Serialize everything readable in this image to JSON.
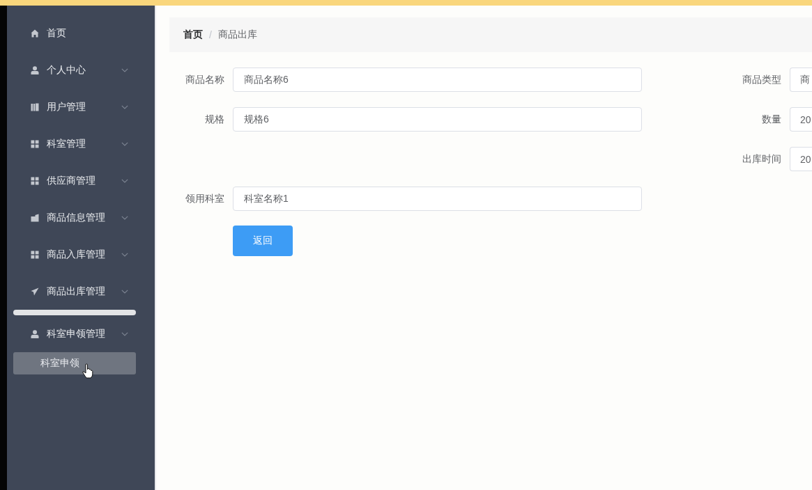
{
  "sidebar": {
    "items": [
      {
        "label": "首页",
        "kind": "link"
      },
      {
        "label": "个人中心",
        "kind": "submenu"
      },
      {
        "label": "用户管理",
        "kind": "submenu"
      },
      {
        "label": "科室管理",
        "kind": "submenu"
      },
      {
        "label": "供应商管理",
        "kind": "submenu"
      },
      {
        "label": "商品信息管理",
        "kind": "submenu"
      },
      {
        "label": "商品入库管理",
        "kind": "submenu"
      },
      {
        "label": "商品出库管理",
        "kind": "submenu"
      },
      {
        "kind": "bar"
      },
      {
        "label": "科室申领管理",
        "kind": "submenu",
        "children": [
          {
            "label": "科室申领"
          }
        ]
      }
    ]
  },
  "breadcrumb": {
    "items": [
      {
        "label": "首页"
      },
      {
        "label": "商品出库"
      }
    ],
    "separator": "/"
  },
  "form": {
    "rows": [
      {
        "left": {
          "label": "商品名称",
          "value": "商品名称6"
        },
        "right": {
          "label": "商品类型",
          "value": "商"
        }
      },
      {
        "left": {
          "label": "规格",
          "value": "规格6"
        },
        "right": {
          "label": "数量",
          "value": "20"
        }
      },
      {
        "right": {
          "label": "出库时间",
          "value": "20"
        }
      },
      {
        "left": {
          "label": "领用科室",
          "value": "科室名称1"
        }
      }
    ],
    "back_button": {
      "label": "返回"
    }
  }
}
